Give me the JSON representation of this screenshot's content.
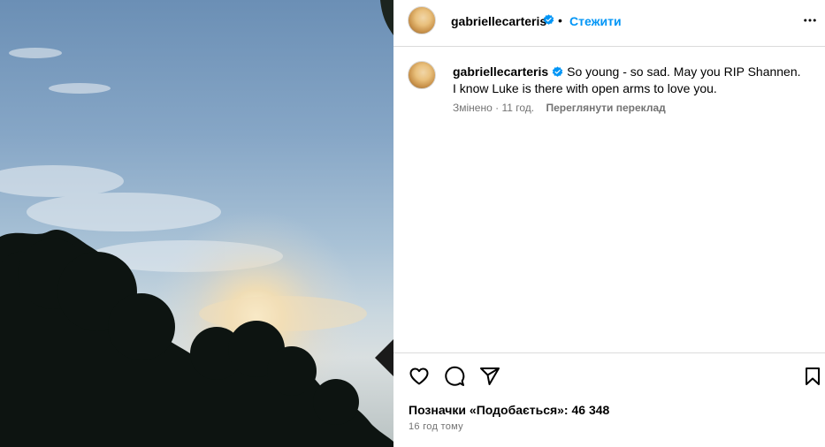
{
  "post": {
    "username": "gabriellecarteris",
    "separator": "•",
    "follow_label": "Стежити"
  },
  "caption": {
    "username": "gabriellecarteris",
    "text": "So young - so sad. May you RIP Shannen. I know Luke is there with open arms to love you.",
    "edited_label": "Змінено",
    "edited_time": "11 год.",
    "translate_label": "Переглянути переклад"
  },
  "engagement": {
    "likes_label": "Позначки «Подобається»: 46 348",
    "posted_time": "16 год тому"
  },
  "icons": {
    "verified": "verified-badge-icon",
    "more": "more-options-icon",
    "like": "heart-icon",
    "comment": "comment-icon",
    "share": "share-icon",
    "save": "bookmark-icon"
  },
  "colors": {
    "link_blue": "#0095f6",
    "secondary_text": "#737373",
    "border": "#dbdbdb",
    "verified": "#0095f6"
  }
}
